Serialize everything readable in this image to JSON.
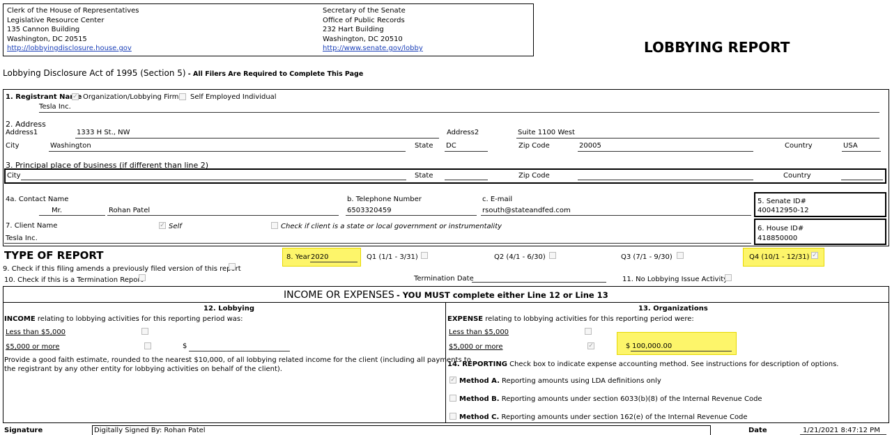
{
  "clerk": {
    "line1": "Clerk of the House of Representatives",
    "line2": "Legislative Resource Center",
    "line3": "135 Cannon Building",
    "line4": "Washington, DC 20515",
    "link": "http://lobbyingdisclosure.house.gov"
  },
  "senate_sec": {
    "line1": "Secretary of the Senate",
    "line2": "Office of Public Records",
    "line3": "232 Hart Building",
    "line4": "Washington, DC 20510",
    "link": "http://www.senate.gov/lobby"
  },
  "report_title": "LOBBYING REPORT",
  "act": {
    "title": "Lobbying Disclosure Act of 1995 (Section 5)",
    "note": "- All Filers Are Required to Complete This Page"
  },
  "registrant": {
    "label": "1. Registrant Name",
    "opt_org": "Organization/Lobbying Firm",
    "opt_self": "Self Employed Individual",
    "org_checked": true,
    "self_checked": false,
    "name": "Tesla Inc."
  },
  "address": {
    "label": "2. Address",
    "address1_label": "Address1",
    "address1": "1333 H St., NW",
    "address2_label": "Address2",
    "address2": "Suite 1100 West",
    "city_label": "City",
    "city": "Washington",
    "state_label": "State",
    "state": "DC",
    "zip_label": "Zip Code",
    "zip": "20005",
    "country_label": "Country",
    "country": "USA"
  },
  "principal": {
    "label": "3. Principal place of business (if different than line 2)",
    "city_label": "City",
    "state_label": "State",
    "zip_label": "Zip Code",
    "country_label": "Country"
  },
  "contact": {
    "label": "4a. Contact Name",
    "prefix": "Mr.",
    "name": "Rohan Patel",
    "phone_label": "b. Telephone Number",
    "phone": "6503320459",
    "email_label": "c. E-mail",
    "email": "rsouth@stateandfed.com"
  },
  "senate_id": {
    "label": "5. Senate ID#",
    "value": "400412950-12"
  },
  "house_id": {
    "label": "6. House ID#",
    "value": "418850000"
  },
  "client": {
    "label": "7. Client Name",
    "self_label": "Self",
    "self_checked": true,
    "state_label": "Check if client is a state or local government or instrumentality",
    "name": "Tesla Inc."
  },
  "type_of_report": {
    "heading": "TYPE OF REPORT",
    "year_label": "8. Year",
    "year": "2020",
    "q1": "Q1 (1/1 - 3/31)",
    "q2": "Q2 (4/1 - 6/30)",
    "q3": "Q3 (7/1 - 9/30)",
    "q4": "Q4 (10/1 - 12/31)",
    "q4_checked": true,
    "amend_label": "9. Check if this filing amends a previously filed version of this report",
    "term_label": "10. Check if this is a Termination Report",
    "term_date_label": "Termination Date",
    "no_activity_label": "11. No Lobbying Issue Activity"
  },
  "income_expenses": {
    "heading": "INCOME OR EXPENSES",
    "heading_note": "- YOU MUST complete either Line 12 or Line 13",
    "lobbying": {
      "heading": "12. Lobbying",
      "intro_bold": "INCOME",
      "intro_rest": " relating to lobbying activities for this reporting period was:",
      "less_than": "Less than $5,000",
      "or_more": "$5,000 or more",
      "dollar": "$",
      "estimate_line1": "Provide a good faith estimate, rounded to the nearest $10,000, of all lobbying related income for the client (including all payments to",
      "estimate_line2": "the registrant by any other entity for lobbying activities on behalf of the client)."
    },
    "organizations": {
      "heading": "13. Organizations",
      "intro_bold": "EXPENSE",
      "intro_rest": " relating to lobbying activities for this reporting period were:",
      "less_than": "Less than $5,000",
      "or_more": "$5,000 or more",
      "or_more_checked": true,
      "dollar": "$",
      "amount": "100,000.00",
      "reporting_bold": "14. REPORTING",
      "reporting_rest": " Check box to indicate expense accounting method. See instructions for description of options.",
      "method_a_bold": "Method A.",
      "method_a": " Reporting amounts using LDA definitions only",
      "method_a_checked": true,
      "method_b_bold": "Method B.",
      "method_b": " Reporting amounts under section 6033(b)(8) of the Internal Revenue Code",
      "method_c_bold": "Method C.",
      "method_c": " Reporting amounts under section 162(e) of the Internal Revenue Code"
    }
  },
  "signature": {
    "label": "Signature",
    "value": "Digitally Signed By: Rohan Patel",
    "date_label": "Date",
    "date": "1/21/2021 8:47:12 PM"
  },
  "colors": {
    "highlight": "#fdf56a",
    "link": "#1a3fb8"
  }
}
